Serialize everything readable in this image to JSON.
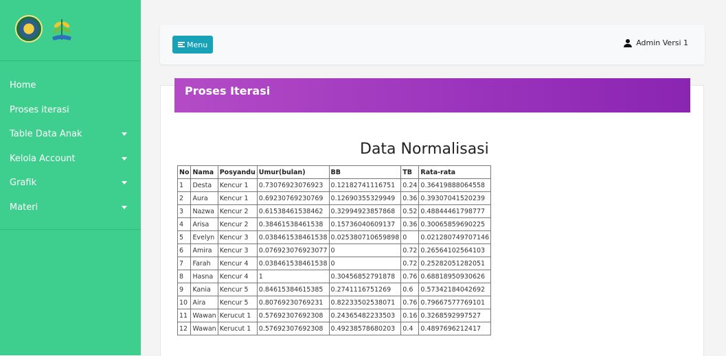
{
  "sidebar": {
    "items": [
      {
        "label": "Home",
        "has_submenu": false
      },
      {
        "label": "Proses iterasi",
        "has_submenu": false
      },
      {
        "label": "Table Data Anak",
        "has_submenu": true
      },
      {
        "label": "Kelola Account",
        "has_submenu": true
      },
      {
        "label": "Grafik",
        "has_submenu": true
      },
      {
        "label": "Materi",
        "has_submenu": true
      }
    ]
  },
  "topbar": {
    "menu_label": "Menu",
    "user_name": "Admin Versi 1"
  },
  "card": {
    "title": "Proses Iterasi"
  },
  "table": {
    "title": "Data Normalisasi",
    "headers": [
      "No",
      "Nama",
      "Posyandu",
      "Umur(bulan)",
      "BB",
      "TB",
      "Rata-rata"
    ],
    "rows": [
      [
        "1",
        "Desta",
        "Kencur 1",
        "0.73076923076923",
        "0.12182741116751",
        "0.24",
        "0.36419888064558"
      ],
      [
        "2",
        "Aura",
        "Kencur 1",
        "0.69230769230769",
        "0.12690355329949",
        "0.36",
        "0.39307041520239"
      ],
      [
        "3",
        "Nazwa",
        "Kencur 2",
        "0.61538461538462",
        "0.32994923857868",
        "0.52",
        "0.48844461798777"
      ],
      [
        "4",
        "Arisa",
        "Kencur 2",
        "0.38461538461538",
        "0.15736040609137",
        "0.36",
        "0.30065859690225"
      ],
      [
        "5",
        "Evelyn",
        "Kencur 3",
        "0.038461538461538",
        "0.025380710659898",
        "0",
        "0.021280749707146"
      ],
      [
        "6",
        "Amira",
        "Kencur 3",
        "0.076923076923077",
        "0",
        "0.72",
        "0.26564102564103"
      ],
      [
        "7",
        "Farah",
        "Kencur 4",
        "0.038461538461538",
        "0",
        "0.72",
        "0.25282051282051"
      ],
      [
        "8",
        "Hasna",
        "Kencur 4",
        "1",
        "0.30456852791878",
        "0.76",
        "0.68818950930626"
      ],
      [
        "9",
        "Kania",
        "Kencur 5",
        "0.84615384615385",
        "0.2741116751269",
        "0.6",
        "0.57342184042692"
      ],
      [
        "10",
        "Aira",
        "Kencur 5",
        "0.80769230769231",
        "0.82233502538071",
        "0.76",
        "0.79667577769101"
      ],
      [
        "11",
        "Wawan",
        "Kerucut 1",
        "0.57692307692308",
        "0.24365482233503",
        "0.16",
        "0.3268592997527"
      ],
      [
        "12",
        "Wawan",
        "Kerucut 1",
        "0.57692307692308",
        "0.49238578680203",
        "0.4",
        "0.4897696212417"
      ]
    ]
  },
  "colors": {
    "sidebar": "#3ecf8e",
    "header_purple": "#9c35bd",
    "menu_button": "#17a2b8"
  }
}
